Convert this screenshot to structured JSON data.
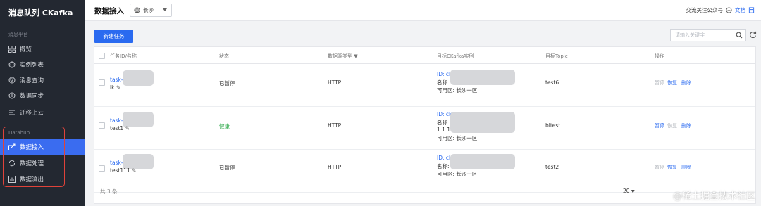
{
  "sidebar": {
    "title": "消息队列 CKafka",
    "group1": "消息平台",
    "items1": [
      {
        "label": "概览",
        "icon": "grid-icon"
      },
      {
        "label": "实例列表",
        "icon": "globe-icon"
      },
      {
        "label": "消息查询",
        "icon": "search-circle-icon"
      },
      {
        "label": "数据同步",
        "icon": "sync-icon"
      },
      {
        "label": "迁移上云",
        "icon": "migrate-icon"
      }
    ],
    "group2": "Datahub",
    "items2": [
      {
        "label": "数据接入",
        "icon": "import-icon",
        "active": true
      },
      {
        "label": "数据处理",
        "icon": "process-icon"
      },
      {
        "label": "数据流出",
        "icon": "export-icon"
      }
    ]
  },
  "topbar": {
    "title": "数据接入",
    "region": "长沙",
    "follow_text": "交流关注公众号",
    "doc_text": "文档"
  },
  "toolbar": {
    "new_task": "新建任务",
    "search_placeholder": "请输入关键字"
  },
  "table": {
    "headers": [
      "任务ID/名称",
      "状态",
      "数据源类型",
      "目标CKafka实例",
      "目标Topic",
      "操作"
    ],
    "rows": [
      {
        "id": "task-",
        "name": "lk",
        "status": "已暂停",
        "source": "HTTP",
        "inst_id": "ID: ck",
        "inst_name": "名称:",
        "inst_name2": "",
        "zone": "可用区: 长沙一区",
        "topic": "test6",
        "ops": [
          "暂停",
          "恢复",
          "删除"
        ]
      },
      {
        "id": "task-",
        "name": "test1",
        "status": "健康",
        "source": "HTTP",
        "inst_id": "ID: ck",
        "inst_name": "名称:",
        "inst_name2": "1.1.1",
        "zone": "可用区: 长沙一区",
        "topic": "bltest",
        "ops": [
          "暂停",
          "恢复",
          "删除"
        ]
      },
      {
        "id": "task-",
        "name": "test111",
        "status": "已暂停",
        "source": "HTTP",
        "inst_id": "ID: ck",
        "inst_name": "名称:",
        "inst_name2": "",
        "zone": "可用区: 长沙一区",
        "topic": "test2",
        "ops": [
          "暂停",
          "恢复",
          "删除"
        ]
      }
    ],
    "total": "共 3 条",
    "page_size": "20"
  },
  "watermark": "@稀土掘金技术社区",
  "colors": {
    "accent": "#2a6af0",
    "sidebar_bg": "#232831",
    "healthy": "#28a745",
    "highlight": "#e0433a"
  }
}
